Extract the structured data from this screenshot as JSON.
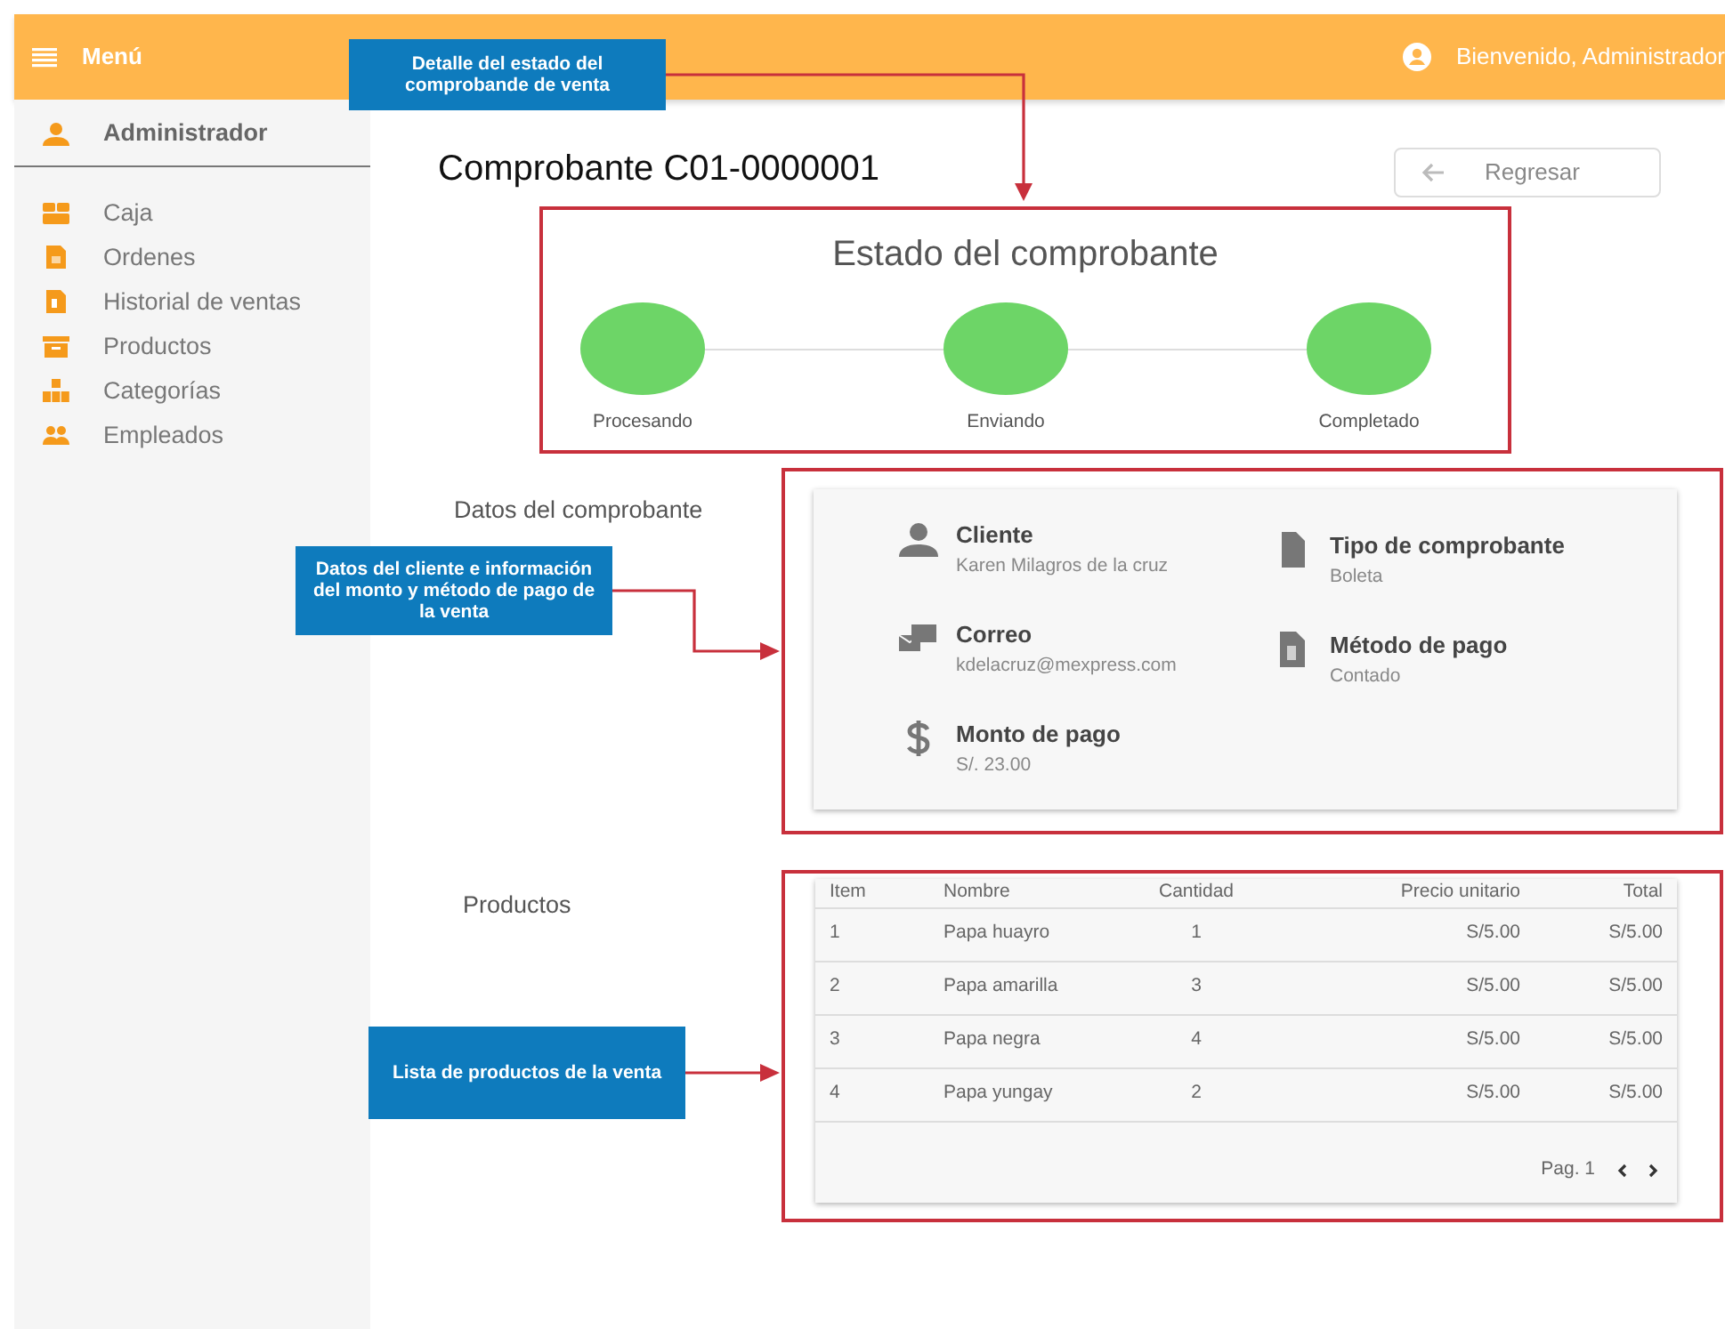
{
  "header": {
    "menu_label": "Menú",
    "welcome": "Bienvenido, Administrador"
  },
  "sidebar": {
    "user": "Administrador",
    "items": [
      {
        "label": "Caja"
      },
      {
        "label": "Ordenes"
      },
      {
        "label": "Historial de ventas"
      },
      {
        "label": "Productos"
      },
      {
        "label": "Categorías"
      },
      {
        "label": "Empleados"
      }
    ]
  },
  "page": {
    "title": "Comprobante C01-0000001",
    "back_button": "Regresar"
  },
  "status": {
    "title": "Estado del comprobante",
    "steps": [
      {
        "label": "Procesando",
        "done": true
      },
      {
        "label": "Enviando",
        "done": true
      },
      {
        "label": "Completado",
        "done": true
      }
    ]
  },
  "details": {
    "heading": "Datos del comprobante",
    "fields": [
      {
        "label": "Cliente",
        "value": "Karen Milagros de la cruz"
      },
      {
        "label": "Tipo de comprobante",
        "value": "Boleta"
      },
      {
        "label": "Correo",
        "value": "kdelacruz@mexpress.com"
      },
      {
        "label": "Método de pago",
        "value": "Contado"
      },
      {
        "label": "Monto de pago",
        "value": "S/. 23.00"
      }
    ]
  },
  "products": {
    "heading": "Productos",
    "table": {
      "columns": [
        "Item",
        "Nombre",
        "Cantidad",
        "Precio unitario",
        "Total"
      ],
      "rows": [
        [
          "1",
          "Papa huayro",
          "1",
          "S/5.00",
          "S/5.00"
        ],
        [
          "2",
          "Papa amarilla",
          "3",
          "S/5.00",
          "S/5.00"
        ],
        [
          "3",
          "Papa negra",
          "4",
          "S/5.00",
          "S/5.00"
        ],
        [
          "4",
          "Papa yungay",
          "2",
          "S/5.00",
          "S/5.00"
        ]
      ]
    },
    "pagination": {
      "page": "Pag. 1"
    }
  },
  "annotations": [
    {
      "text": "Detalle del estado del comprobande de venta"
    },
    {
      "text": "Datos del cliente e información del monto y método de pago de la venta"
    },
    {
      "text": "Lista de productos de la venta"
    }
  ]
}
